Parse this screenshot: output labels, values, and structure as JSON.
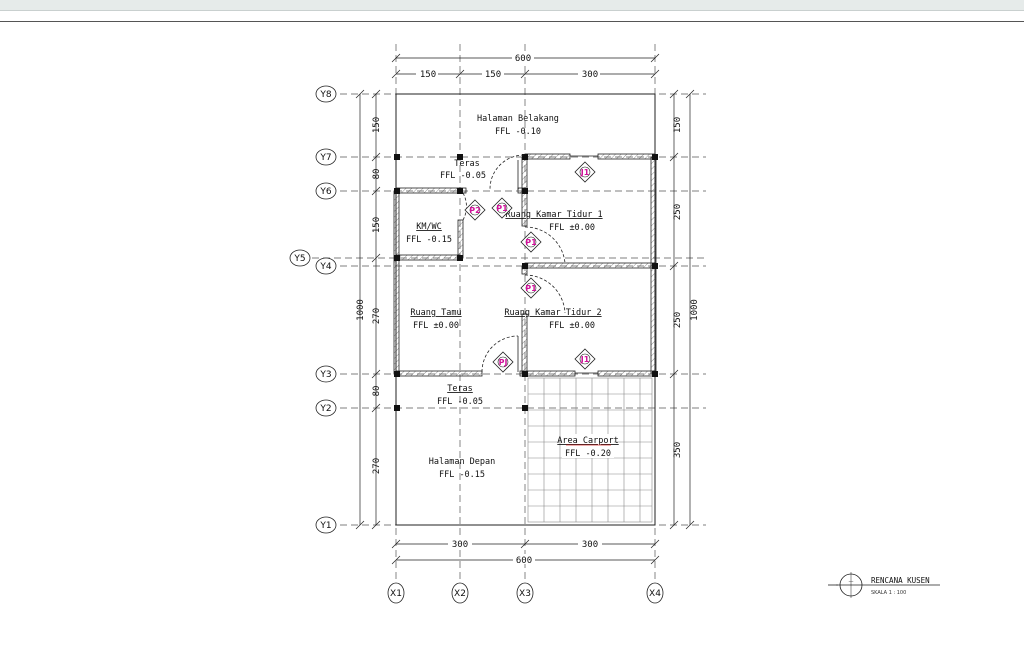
{
  "dims_top": {
    "total": "600",
    "seg1": "150",
    "seg2": "150",
    "seg3": "300"
  },
  "dims_bottom": {
    "total": "600",
    "seg1": "300",
    "seg2": "300"
  },
  "dims_left": {
    "total": "1000",
    "seg1": "150",
    "seg2": "80",
    "seg3": "150",
    "seg4": "270",
    "seg5": "80",
    "seg6": "270"
  },
  "dims_right": {
    "total": "1000",
    "seg1": "150",
    "seg2": "250",
    "seg3": "250",
    "seg4": "350"
  },
  "grid_y": [
    "Y8",
    "Y7",
    "Y6",
    "Y5",
    "Y4",
    "Y3",
    "Y2",
    "Y1"
  ],
  "grid_x": [
    "X1",
    "X2",
    "X3",
    "X4"
  ],
  "rooms": {
    "halaman_belakang": {
      "name": "Halaman Belakang",
      "level": "FFL -0.10"
    },
    "teras_atas": {
      "name": "Teras",
      "level": "FFL -0.05"
    },
    "kmwc": {
      "name": "KM/WC",
      "level": "FFL -0.15"
    },
    "kamar1": {
      "name": "Ruang Kamar Tidur 1",
      "level": "FFL ±0.00"
    },
    "kamar2": {
      "name": "Ruang Kamar Tidur 2",
      "level": "FFL ±0.00"
    },
    "ruang_tamu": {
      "name": "Ruang Tamu",
      "level": "FFL ±0.00"
    },
    "teras_bawah": {
      "name": "Teras",
      "level": "FFL -0.05"
    },
    "halaman_depan": {
      "name": "Halaman Depan",
      "level": "FFL -0.15"
    },
    "carport": {
      "name": "Area Carport",
      "level": "FFL -0.20"
    }
  },
  "tags": {
    "j1": "J1",
    "p1": "P1",
    "p2": "P2",
    "pj": "PJ"
  },
  "title_block": {
    "title": "RENCANA KUSEN",
    "scale": "SKALA 1 : 100"
  },
  "colors": {
    "tag": "#d0129a",
    "line": "#222222",
    "topbar": "#e6ebea"
  }
}
